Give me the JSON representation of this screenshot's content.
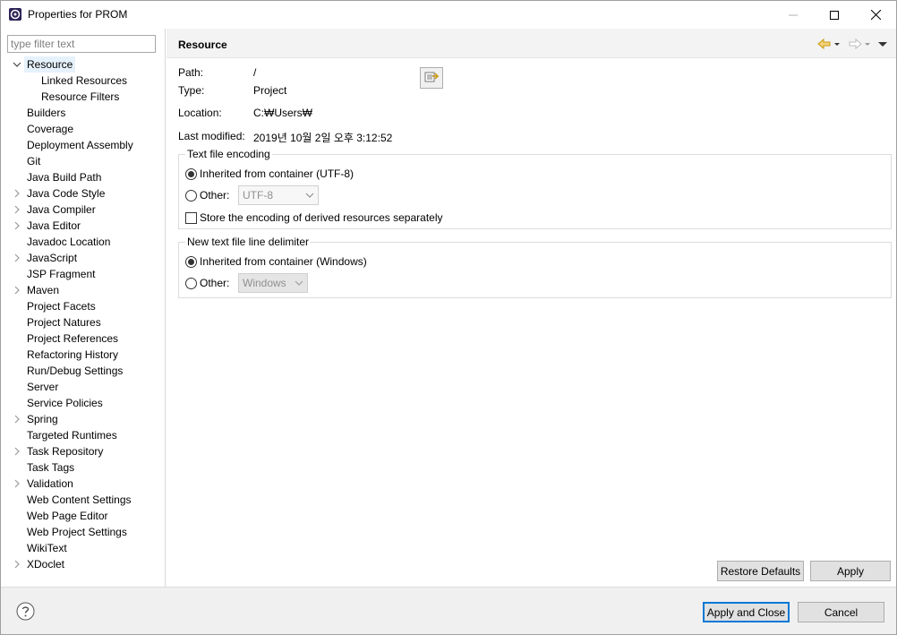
{
  "window": {
    "title": "Properties for PROM",
    "icon": "eclipse-gear-icon",
    "controls": {
      "minimize": "minimize-icon",
      "maximize": "maximize-icon",
      "close": "close-icon"
    }
  },
  "filter": {
    "placeholder": "type filter text",
    "value": ""
  },
  "tree": {
    "items": [
      {
        "label": "Resource",
        "expander": "expanded",
        "level": 0,
        "selected": true
      },
      {
        "label": "Linked Resources",
        "expander": "none",
        "level": 1
      },
      {
        "label": "Resource Filters",
        "expander": "none",
        "level": 1
      },
      {
        "label": "Builders",
        "expander": "none",
        "level": 0
      },
      {
        "label": "Coverage",
        "expander": "none",
        "level": 0
      },
      {
        "label": "Deployment Assembly",
        "expander": "none",
        "level": 0
      },
      {
        "label": "Git",
        "expander": "none",
        "level": 0
      },
      {
        "label": "Java Build Path",
        "expander": "none",
        "level": 0
      },
      {
        "label": "Java Code Style",
        "expander": "collapsed",
        "level": 0
      },
      {
        "label": "Java Compiler",
        "expander": "collapsed",
        "level": 0
      },
      {
        "label": "Java Editor",
        "expander": "collapsed",
        "level": 0
      },
      {
        "label": "Javadoc Location",
        "expander": "none",
        "level": 0
      },
      {
        "label": "JavaScript",
        "expander": "collapsed",
        "level": 0
      },
      {
        "label": "JSP Fragment",
        "expander": "none",
        "level": 0
      },
      {
        "label": "Maven",
        "expander": "collapsed",
        "level": 0
      },
      {
        "label": "Project Facets",
        "expander": "none",
        "level": 0
      },
      {
        "label": "Project Natures",
        "expander": "none",
        "level": 0
      },
      {
        "label": "Project References",
        "expander": "none",
        "level": 0
      },
      {
        "label": "Refactoring History",
        "expander": "none",
        "level": 0
      },
      {
        "label": "Run/Debug Settings",
        "expander": "none",
        "level": 0
      },
      {
        "label": "Server",
        "expander": "none",
        "level": 0
      },
      {
        "label": "Service Policies",
        "expander": "none",
        "level": 0
      },
      {
        "label": "Spring",
        "expander": "collapsed",
        "level": 0
      },
      {
        "label": "Targeted Runtimes",
        "expander": "none",
        "level": 0
      },
      {
        "label": "Task Repository",
        "expander": "collapsed",
        "level": 0
      },
      {
        "label": "Task Tags",
        "expander": "none",
        "level": 0
      },
      {
        "label": "Validation",
        "expander": "collapsed",
        "level": 0
      },
      {
        "label": "Web Content Settings",
        "expander": "none",
        "level": 0
      },
      {
        "label": "Web Page Editor",
        "expander": "none",
        "level": 0
      },
      {
        "label": "Web Project Settings",
        "expander": "none",
        "level": 0
      },
      {
        "label": "WikiText",
        "expander": "none",
        "level": 0
      },
      {
        "label": "XDoclet",
        "expander": "collapsed",
        "level": 0
      }
    ]
  },
  "page": {
    "title": "Resource",
    "nav": {
      "back": "back-arrow-icon",
      "forward": "forward-arrow-icon",
      "menu": "view-menu-icon"
    },
    "props": {
      "path_label": "Path:",
      "path_value": "/",
      "type_label": "Type:",
      "type_value": "Project",
      "location_label": "Location:",
      "location_value": "C:₩Users₩",
      "modified_label": "Last modified:",
      "modified_value": "2019년 10월 2일 오후 3:12:52"
    },
    "encoding": {
      "group_title": "Text file encoding",
      "inherited_label": "Inherited from container (UTF-8)",
      "other_label": "Other:",
      "other_value": "UTF-8",
      "store_derived_label": "Store the encoding of derived resources separately"
    },
    "delimiter": {
      "group_title": "New text file line delimiter",
      "inherited_label": "Inherited from container (Windows)",
      "other_label": "Other:",
      "other_value": "Windows"
    },
    "restore_defaults": "Restore Defaults",
    "apply": "Apply"
  },
  "footer": {
    "help": "help-icon",
    "apply_close": "Apply and Close",
    "cancel": "Cancel"
  }
}
